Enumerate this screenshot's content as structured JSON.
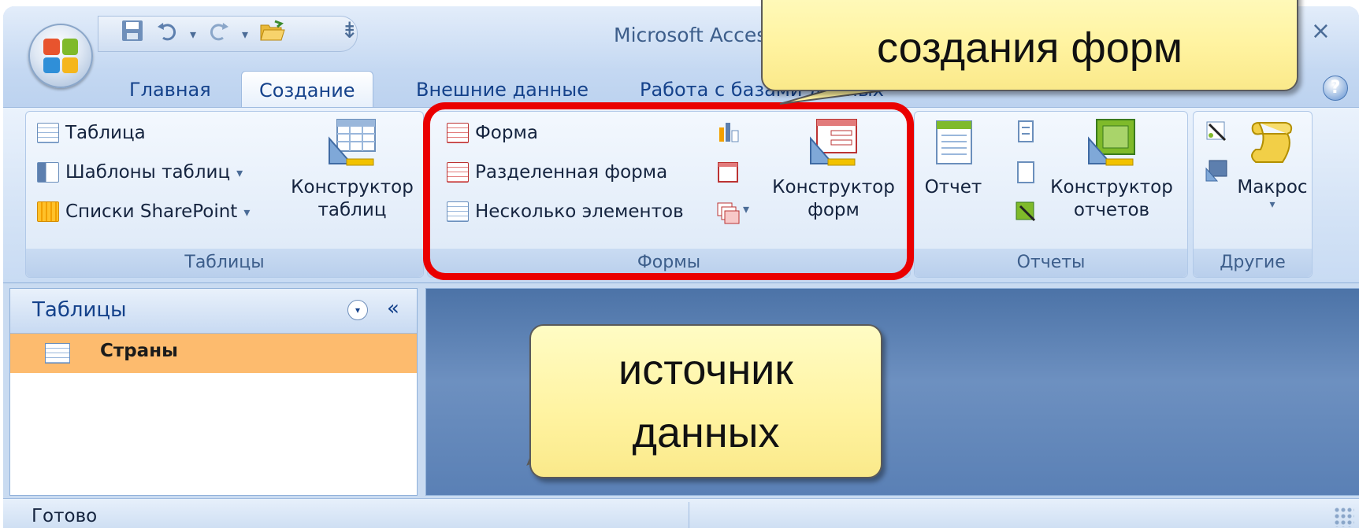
{
  "window": {
    "title": "Microsoft Acces",
    "controls": "− ×"
  },
  "qat": {
    "save_icon": "save-icon",
    "undo_icon": "undo-icon",
    "redo_icon": "redo-icon",
    "open_icon": "open-folder-icon",
    "more": "⇟"
  },
  "tabs": [
    {
      "label": "Главная"
    },
    {
      "label": "Создание"
    },
    {
      "label": "Внешние данные"
    },
    {
      "label": "Работа с базами данных"
    }
  ],
  "help": "?",
  "ribbon": {
    "tables": {
      "label": "Таблицы",
      "table": "Таблица",
      "templates": "Шаблоны таблиц",
      "sharepoint": "Списки SharePoint",
      "designer_line1": "Конструктор",
      "designer_line2": "таблиц"
    },
    "forms": {
      "label": "Формы",
      "form": "Форма",
      "split_form": "Разделенная форма",
      "multiple_items": "Несколько элементов",
      "designer_line1": "Конструктор",
      "designer_line2": "форм"
    },
    "reports": {
      "label": "Отчеты",
      "report": "Отчет",
      "designer_line1": "Конструктор",
      "designer_line2": "отчетов"
    },
    "other": {
      "label": "Другие",
      "macro": "Макрос"
    },
    "dropdown_arrow": "▾"
  },
  "nav": {
    "title": "Таблицы",
    "dropdown": "▾",
    "collapse": "«",
    "items": [
      {
        "label": "Страны"
      }
    ]
  },
  "status": {
    "text": "Готово"
  },
  "callouts": {
    "top_line2": "создания форм",
    "bottom_line1": "источник",
    "bottom_line2": "данных"
  },
  "colors": {
    "highlight": "#ea0000",
    "callout_fill": "#fff3a0",
    "selected_item": "#fdbb6e",
    "workspace": "#5a80b5"
  }
}
